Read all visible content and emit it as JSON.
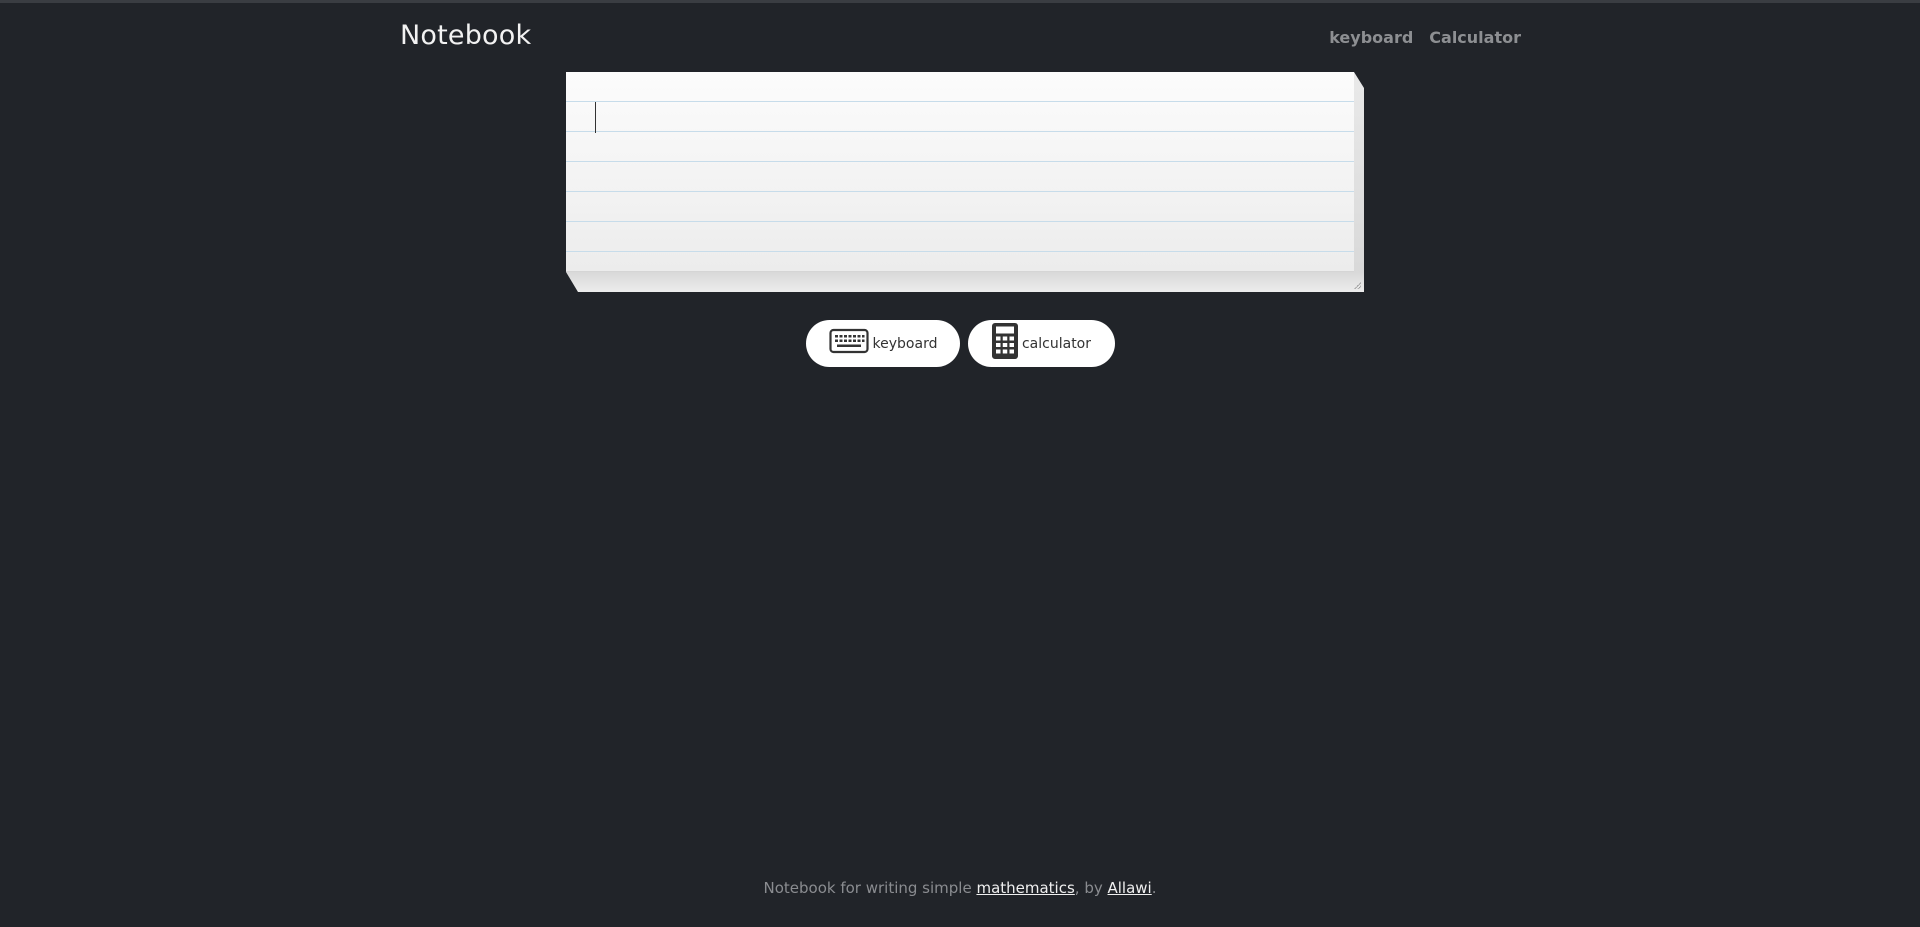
{
  "header": {
    "brand": "Notebook",
    "nav": {
      "keyboard": "keyboard",
      "calculator": "Calculator"
    }
  },
  "editor": {
    "value": ""
  },
  "buttons": {
    "keyboard": "keyboard",
    "calculator": "calculator"
  },
  "footer": {
    "prefix": "Notebook for writing simple ",
    "link1": "mathematics",
    "middle": ", by ",
    "link2": "Allawi",
    "suffix": "."
  },
  "colors": {
    "background": "#212429",
    "nav_text": "#8d8f92",
    "paper_line": "#c7dcea"
  }
}
